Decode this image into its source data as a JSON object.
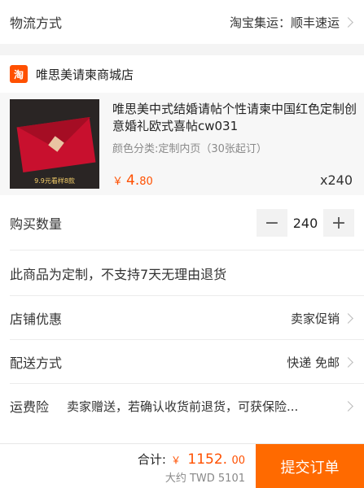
{
  "shipping": {
    "label": "物流方式",
    "value": "淘宝集运：顺丰速运"
  },
  "shop": {
    "logo_text": "淘",
    "name": "唯思美请柬商城店"
  },
  "product": {
    "title": "唯思美中式结婚请帖个性请柬中国红色定制创意婚礼欧式喜帖cw031",
    "spec": "颜色分类:定制内页（30张起订）",
    "thumb_caption": "9.9元看样8款",
    "price_currency": "￥",
    "price_int": "4.",
    "price_dec": "80",
    "quantity_text": "x240"
  },
  "quantity": {
    "label": "购买数量",
    "minus": "−",
    "value": "240",
    "plus": "+"
  },
  "custom_notice": "此商品为定制，不支持7天无理由退货",
  "discount": {
    "label": "店铺优惠",
    "value": "卖家促销"
  },
  "delivery": {
    "label": "配送方式",
    "value": "快递 免邮"
  },
  "insurance": {
    "label": "运费险",
    "value": "卖家赠送，若确认收货前退货，可获保险..."
  },
  "bottom": {
    "total_label": "合计:",
    "total_currency": "￥",
    "total_int": "1152.",
    "total_dec": "00",
    "approx": "大约 TWD 5101",
    "submit_label": "提交订单"
  },
  "colors": {
    "accent": "#ff5000",
    "submit_bg": "#ff6a00"
  }
}
